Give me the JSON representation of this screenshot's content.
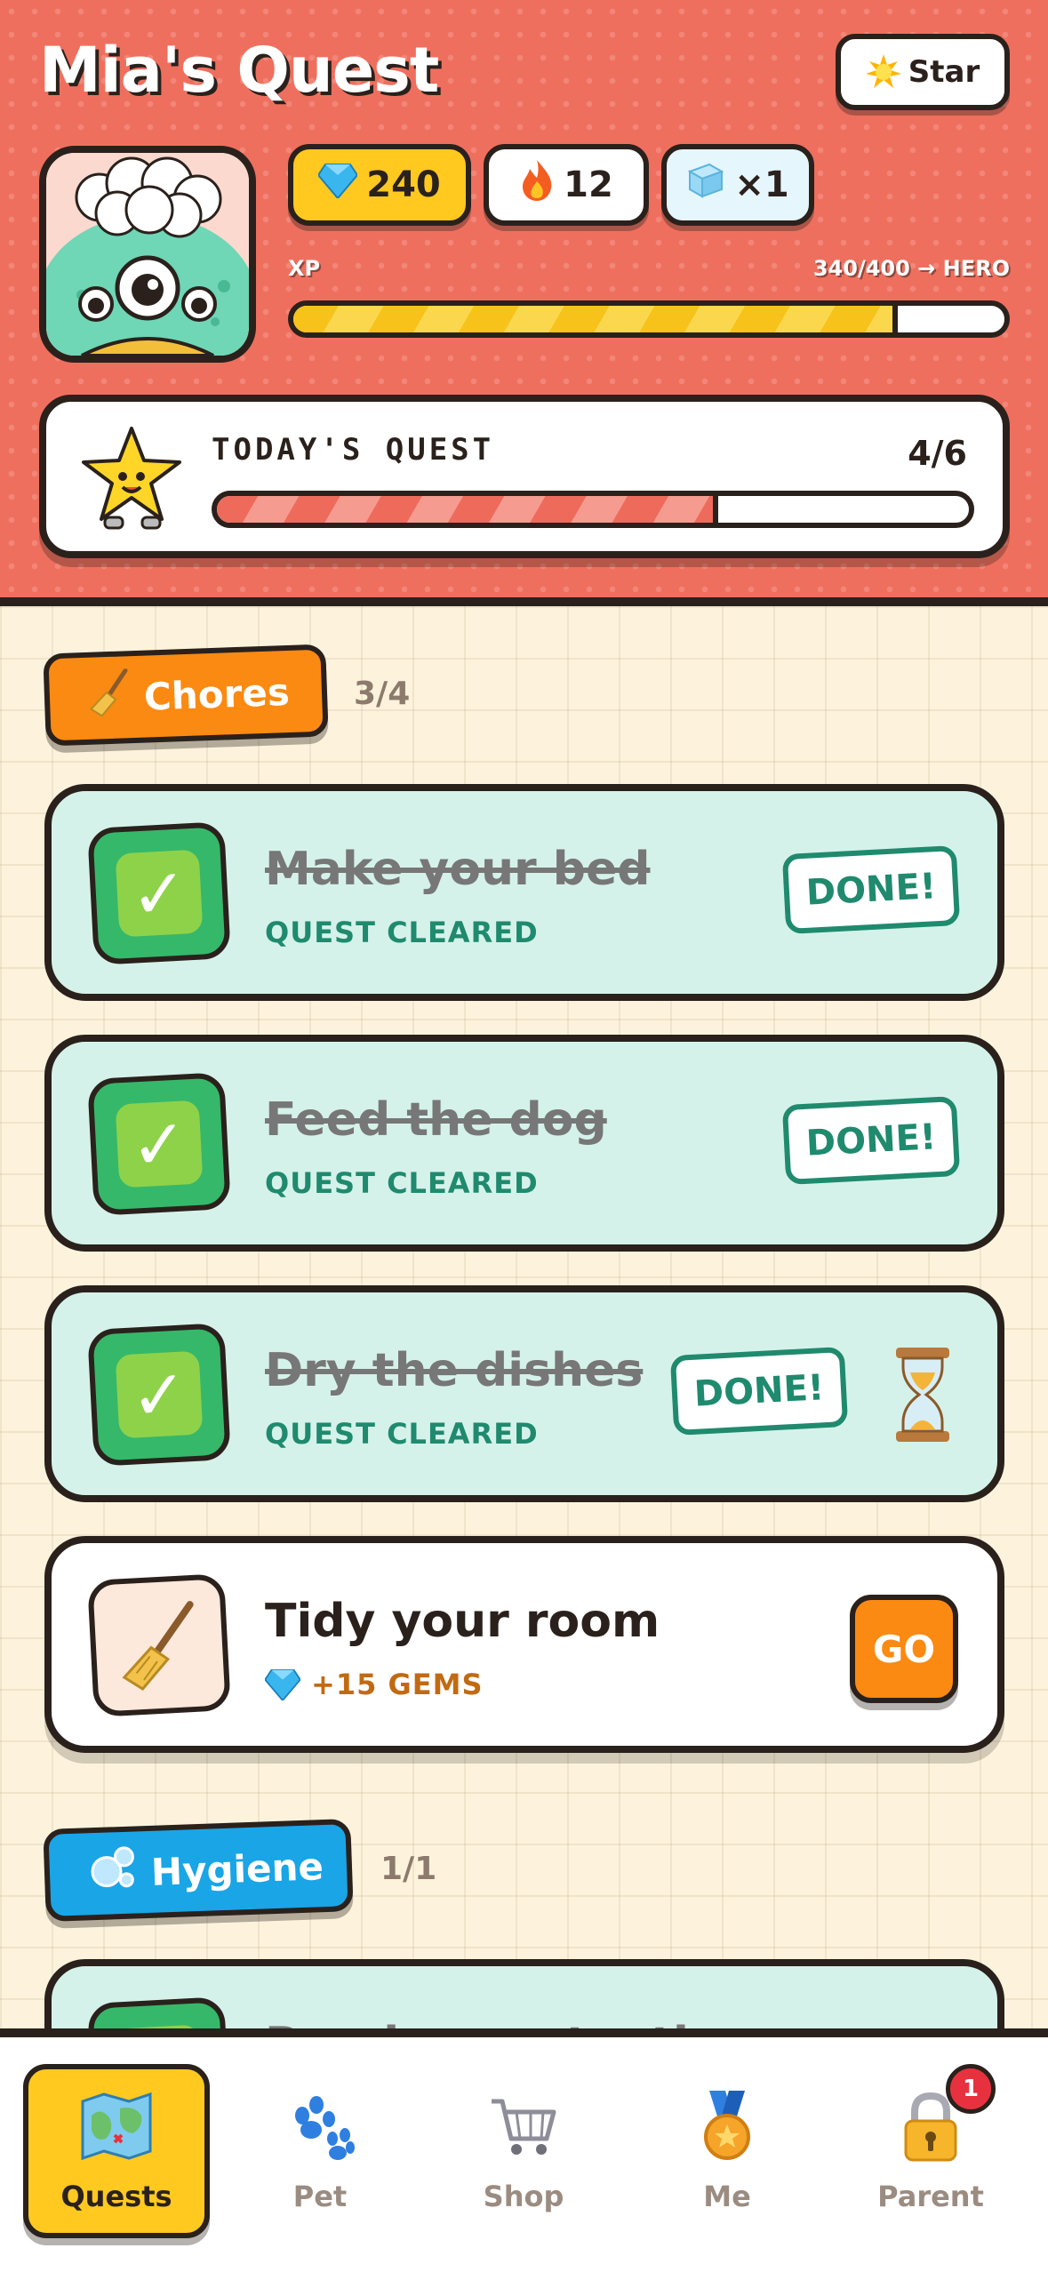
{
  "header": {
    "title": "Mia's Quest",
    "star_button": "Star",
    "stats": {
      "gems": "240",
      "streak": "12",
      "freeze": "×1"
    },
    "xp": {
      "label": "XP",
      "value": "340/400 → HERO",
      "progress": 0.85
    }
  },
  "todays_quest": {
    "title": "TODAY'S QUEST",
    "count": "4/6",
    "progress": 0.6667
  },
  "categories": [
    {
      "label": "Chores",
      "count": "3/4",
      "tasks": [
        {
          "name": "Make your bed",
          "status": "QUEST CLEARED",
          "action": "DONE!",
          "done": true
        },
        {
          "name": "Feed the dog",
          "status": "QUEST CLEARED",
          "action": "DONE!",
          "done": true
        },
        {
          "name": "Dry the dishes",
          "status": "QUEST CLEARED",
          "action": "DONE!",
          "done": true,
          "icon": "hourglass-icon"
        },
        {
          "name": "Tidy your room",
          "reward": "+15 GEMS",
          "action": "GO",
          "done": false
        }
      ]
    },
    {
      "label": "Hygiene",
      "count": "1/1",
      "tasks": [
        {
          "name": "Brush your teeth",
          "done": true
        }
      ]
    }
  ],
  "nav": {
    "items": [
      {
        "label": "Quests",
        "icon": "map-icon",
        "active": true
      },
      {
        "label": "Pet",
        "icon": "paw-icon",
        "active": false
      },
      {
        "label": "Shop",
        "icon": "cart-icon",
        "active": false
      },
      {
        "label": "Me",
        "icon": "medal-icon",
        "active": false
      },
      {
        "label": "Parent",
        "icon": "lock-icon",
        "active": false
      }
    ],
    "parent_badge": "1"
  },
  "colors": {
    "header_bg": "#ef6f5e",
    "gems_chip": "#ffc91f",
    "chores": "#fb8a12",
    "hygiene": "#1aa5e6",
    "done_card": "#d5f2ea",
    "done_text": "#1f8a6e",
    "outline": "#2a211c"
  }
}
